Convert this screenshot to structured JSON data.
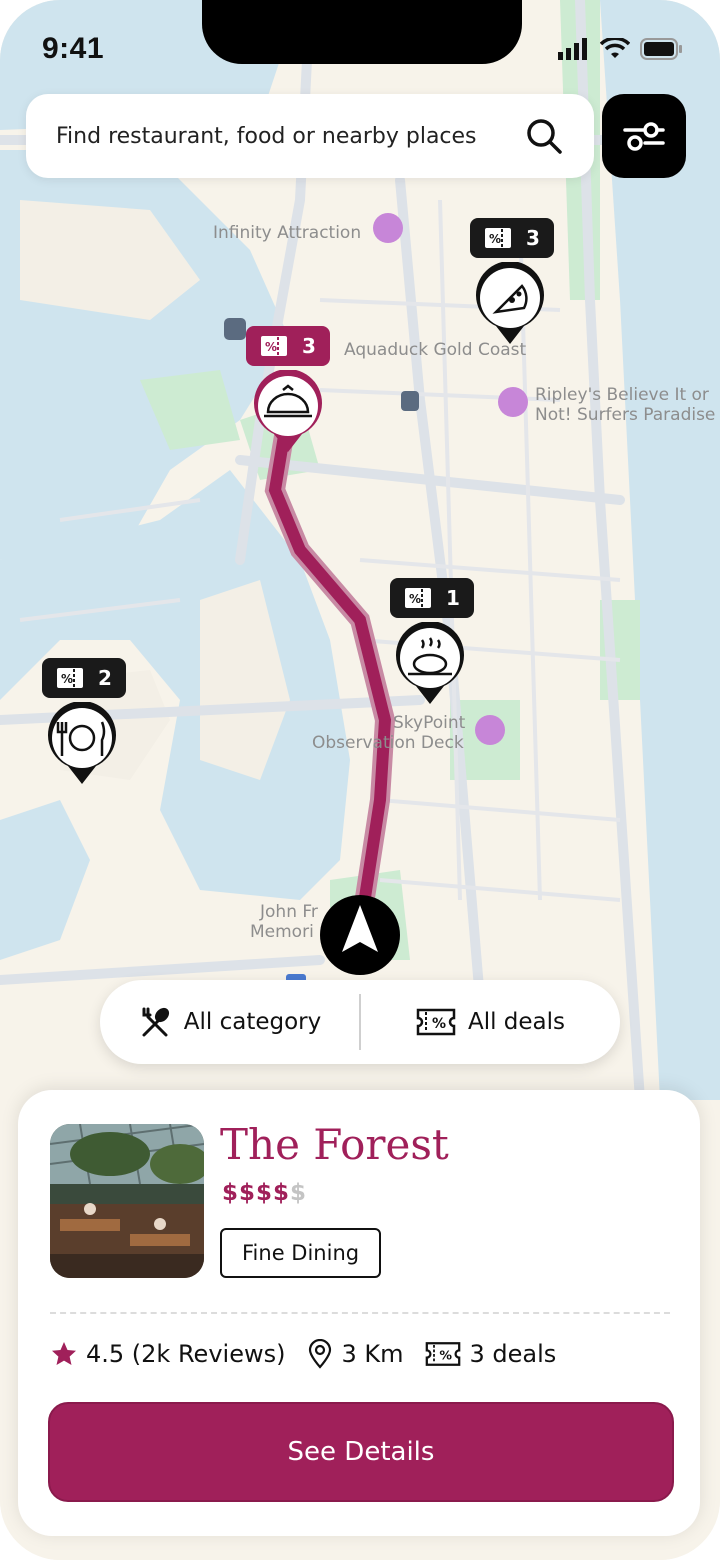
{
  "status_bar": {
    "time": "9:41"
  },
  "search": {
    "placeholder": "Find restaurant, food or nearby places"
  },
  "map": {
    "labels": {
      "infinity": "Infinity Attraction",
      "aquaduck": "Aquaduck Gold Coast",
      "ripley_1": "Ripley's Believe It or",
      "ripley_2": "Not! Surfers Paradise",
      "skypoint_1": "SkyPoint",
      "skypoint_2": "Observation Deck",
      "john_1": "John Fr",
      "john_2": "Memori"
    },
    "pins": [
      {
        "name": "pizza",
        "deals": "3"
      },
      {
        "name": "dining-cloche",
        "deals": "3"
      },
      {
        "name": "roast-chicken",
        "deals": "1"
      },
      {
        "name": "fork-plate-knife",
        "deals": "2"
      }
    ]
  },
  "filters": {
    "category": "All category",
    "deals": "All deals"
  },
  "restaurant": {
    "name": "The Forest",
    "price_active": "$$$$",
    "price_inactive": "$",
    "tag": "Fine Dining",
    "rating": "4.5 (2k Reviews)",
    "distance": "3 Km",
    "deals": "3 deals",
    "cta": "See Details"
  },
  "colors": {
    "accent": "#a0205a",
    "map_land": "#f7f3ea",
    "map_water": "#cfe4ee",
    "map_park": "#cdebd2"
  },
  "icons": [
    "signal-icon",
    "wifi-icon",
    "battery-icon",
    "search-icon",
    "filter-icon",
    "utensils-icon",
    "ticket-icon",
    "star-icon",
    "location-pin-icon",
    "navigation-arrow-icon"
  ]
}
